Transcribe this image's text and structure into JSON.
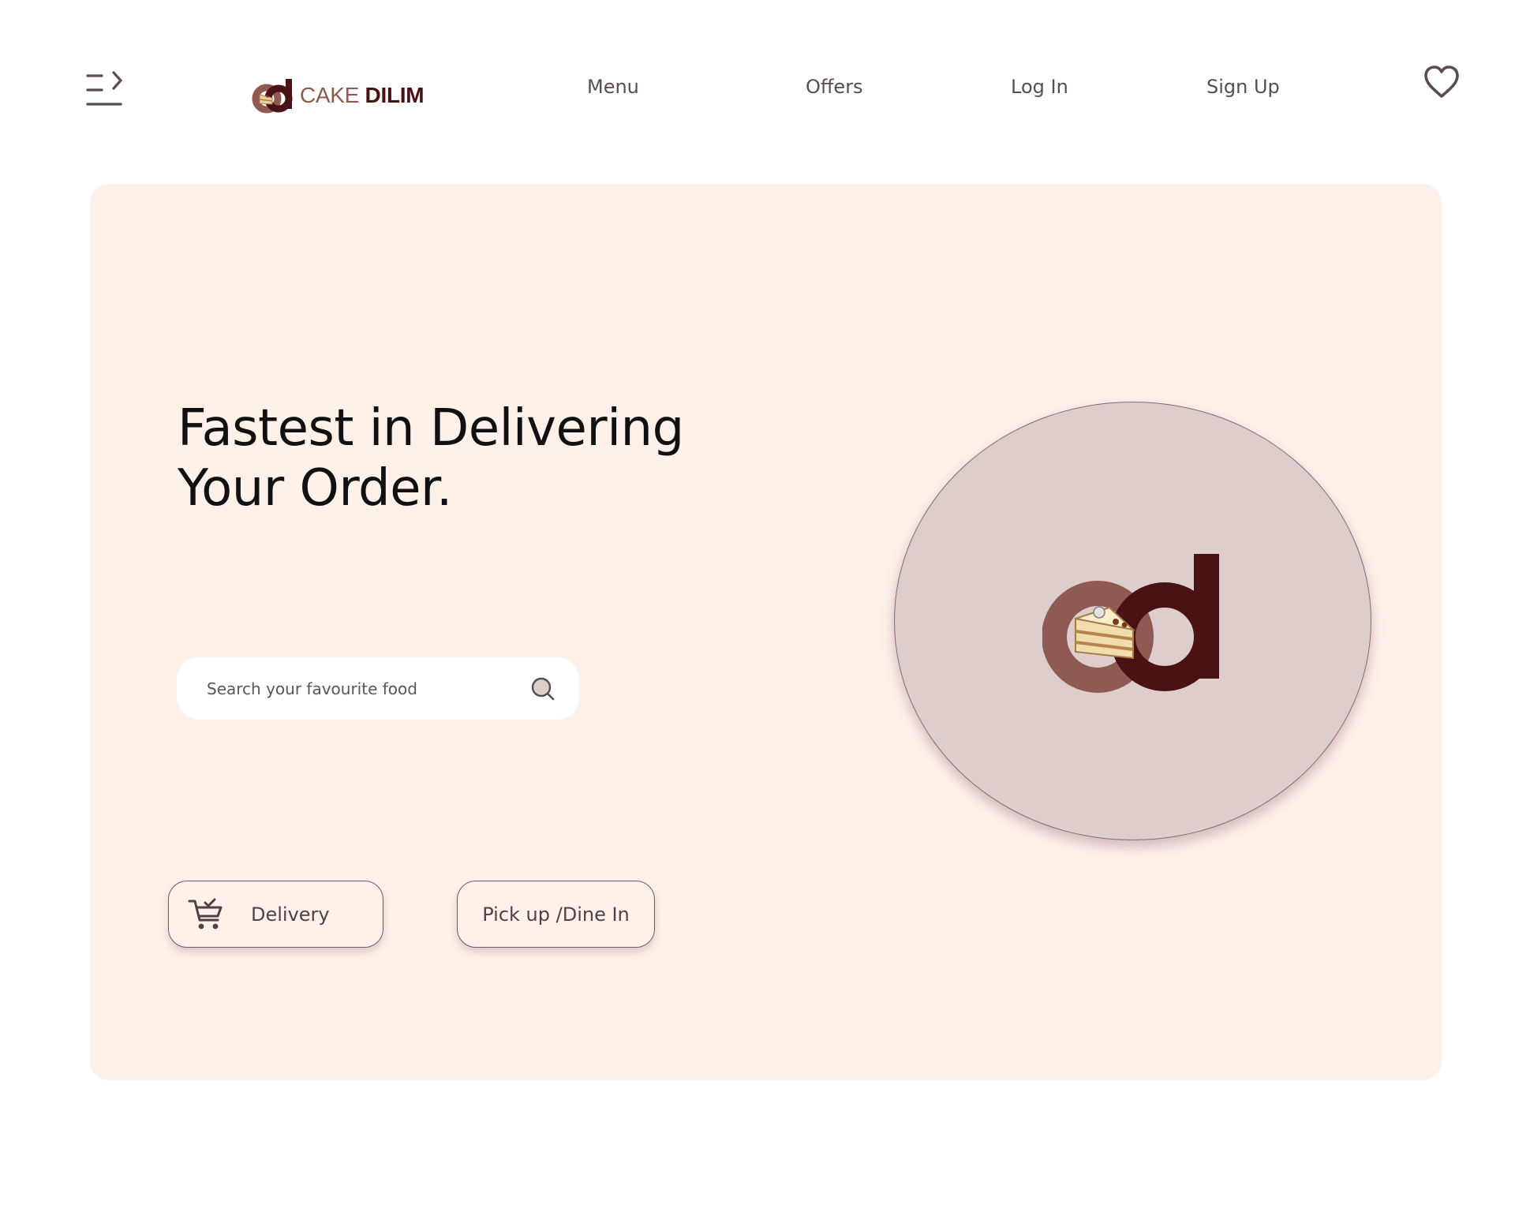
{
  "header": {
    "menu_toggle_icon": "menu-arrow-icon",
    "logo": {
      "word1": "CAKE",
      "word2": "DILIM",
      "icon": "cd-cake-logo"
    },
    "nav": [
      {
        "label": "Menu"
      },
      {
        "label": "Offers"
      },
      {
        "label": "Log In"
      },
      {
        "label": "Sign Up"
      }
    ],
    "favorites_icon": "heart-icon"
  },
  "hero": {
    "headline_line1": "Fastest in Delivering",
    "headline_line2": "Your Order.",
    "search": {
      "placeholder": "Search your favourite food",
      "value": "",
      "icon": "search-icon"
    },
    "buttons": {
      "delivery": "Delivery",
      "delivery_icon": "cart-icon",
      "pickup": "Pick up /Dine In"
    },
    "image_icon": "cd-cake-logo"
  },
  "colors": {
    "hero_bg": "#fef1ea",
    "circle_bg": "#ddcecc",
    "brand_dark": "#4a1214",
    "brand_light": "#8f5a52",
    "text": "#5b4b52"
  }
}
